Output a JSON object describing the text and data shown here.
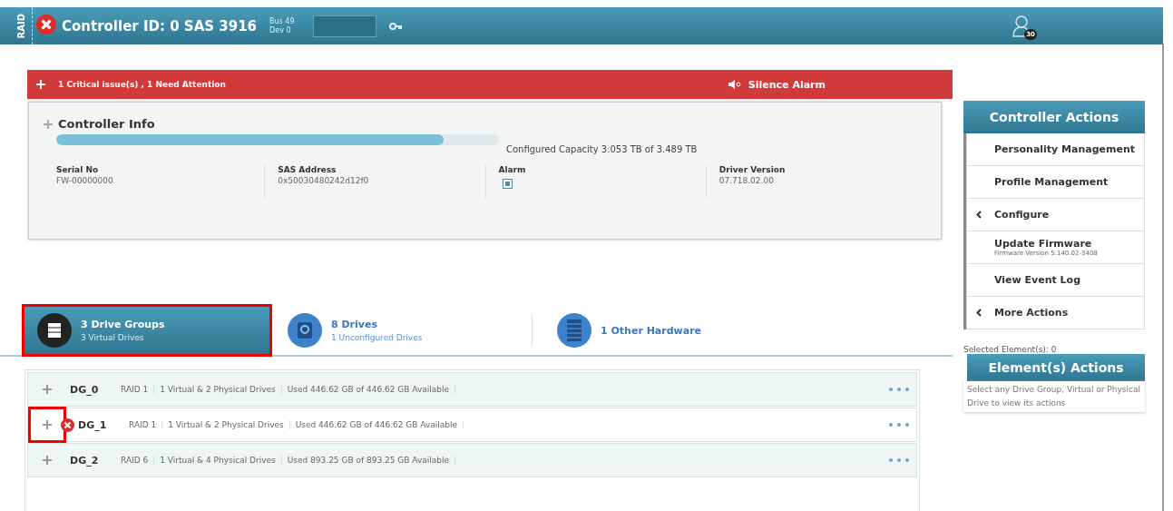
{
  "header": {
    "raid_label": "RAID",
    "error": true,
    "title": "Controller ID: 0 SAS 3916",
    "bus": "Bus 49",
    "dev": "Dev 0",
    "user_badge": "30"
  },
  "alert": {
    "text": "1 Critical issue(s) , 1 Need Attention",
    "action": "Silence Alarm"
  },
  "controller_info": {
    "title": "Controller Info",
    "capacity": {
      "level": 0.875,
      "text": "Configured Capacity 3.053 TB of 3.489 TB"
    },
    "fields": [
      {
        "kind": "text",
        "label": "Serial No",
        "value": "FW-00000000"
      },
      {
        "kind": "text",
        "label": "SAS Address",
        "value": "0x50030480242d12f0"
      },
      {
        "kind": "checkbox",
        "label": "Alarm",
        "checked": true
      },
      {
        "kind": "text",
        "label": "Driver Version",
        "value": "07.718.02.00"
      }
    ]
  },
  "tabs": [
    {
      "kind": "groups",
      "title": "3 Drive Groups",
      "subtitle": "3 Virtual Drives",
      "selected": true,
      "highlighted": true
    },
    {
      "kind": "drives",
      "title": "8 Drives",
      "subtitle": "1 Unconfigured Drives",
      "selected": false,
      "highlighted": false
    },
    {
      "kind": "hardware",
      "title": "1 Other Hardware",
      "selected": false,
      "highlighted": false
    }
  ],
  "drive_groups": [
    {
      "name": "DG_0",
      "error": false,
      "highlighted": false,
      "raid": "RAID 1",
      "drives": "1 Virtual & 2 Physical Drives",
      "usage": "Used 446.62 GB of 446.62 GB Available"
    },
    {
      "name": "DG_1",
      "error": true,
      "highlighted": true,
      "raid": "RAID 1",
      "drives": "1 Virtual & 2 Physical Drives",
      "usage": "Used 446.62 GB of 446.62 GB Available"
    },
    {
      "name": "DG_2",
      "error": false,
      "highlighted": false,
      "raid": "RAID 6",
      "drives": "1 Virtual & 4 Physical Drives",
      "usage": "Used 893.25 GB of 893.25 GB Available"
    }
  ],
  "controller_actions": {
    "title": "Controller Actions",
    "items": [
      {
        "label": "Personality Management",
        "submenu": false
      },
      {
        "label": "Profile Management",
        "submenu": false
      },
      {
        "label": "Configure",
        "submenu": true
      },
      {
        "label": "Update Firmware",
        "note": "Firmware Version 5.140.02-3408",
        "submenu": false
      },
      {
        "label": "View Event Log",
        "submenu": false
      },
      {
        "label": "More Actions",
        "submenu": true
      }
    ]
  },
  "selected_elements": "Selected Element(s): 0",
  "element_actions": {
    "title": "Element(s) Actions",
    "hint": "Select any Drive Group, Virtual or Physical Drive to view its actions"
  }
}
